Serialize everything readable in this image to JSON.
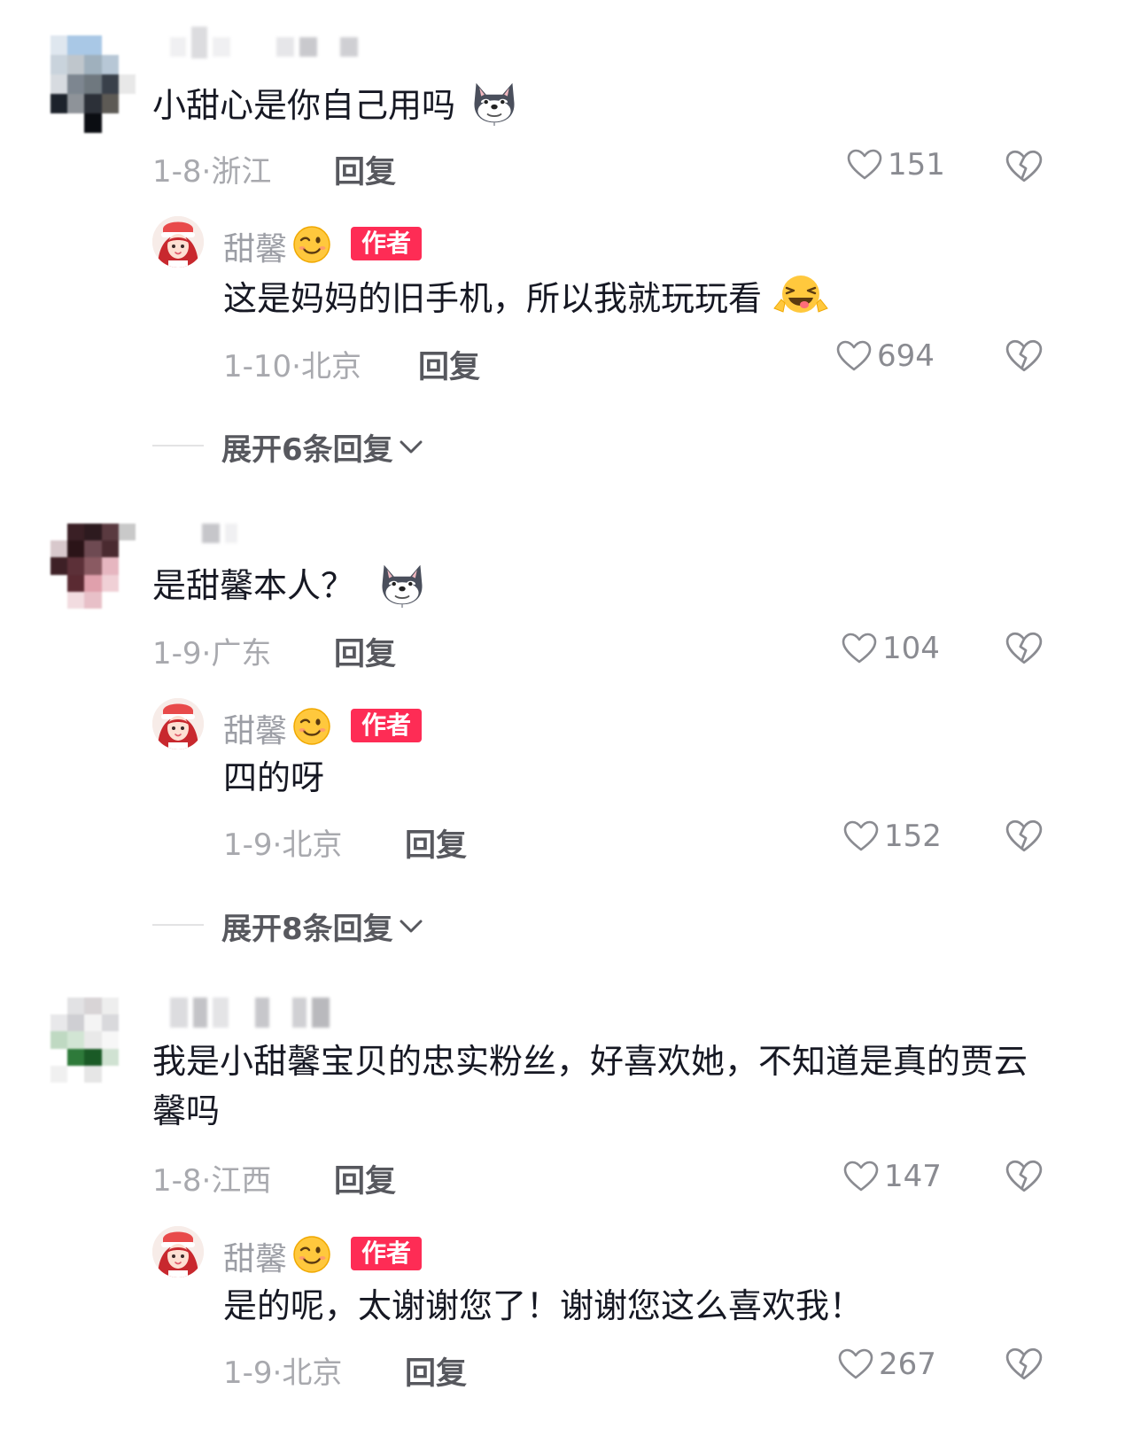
{
  "reply_label": "回复",
  "colors": {
    "author_badge": "#fe2c55",
    "text_primary": "#161823",
    "text_meta": "#a8a9ae"
  },
  "threads": [
    {
      "comment": {
        "text": "小甜心是你自己用吗",
        "emoji": "husky-dog-emoji",
        "date": "1-8",
        "location": "浙江",
        "likes": "151"
      },
      "author_reply": {
        "name": "甜馨",
        "badge": "作者",
        "text": "这是妈妈的旧手机，所以我就玩玩看",
        "emoji": "laughing-tongue-emoji",
        "date": "1-10",
        "location": "北京",
        "likes": "694"
      },
      "expand_label": "展开6条回复"
    },
    {
      "comment": {
        "text": "是甜馨本人？",
        "emoji": "husky-dog-emoji",
        "date": "1-9",
        "location": "广东",
        "likes": "104"
      },
      "author_reply": {
        "name": "甜馨",
        "badge": "作者",
        "text": "四的呀",
        "date": "1-9",
        "location": "北京",
        "likes": "152"
      },
      "expand_label": "展开8条回复"
    },
    {
      "comment": {
        "text": "我是小甜馨宝贝的忠实粉丝，好喜欢她，不知道是真的贾云馨吗",
        "date": "1-8",
        "location": "江西",
        "likes": "147"
      },
      "author_reply": {
        "name": "甜馨",
        "badge": "作者",
        "text": "是的呢，太谢谢您了！谢谢您这么喜欢我！",
        "date": "1-9",
        "location": "北京",
        "likes": "267"
      }
    }
  ]
}
